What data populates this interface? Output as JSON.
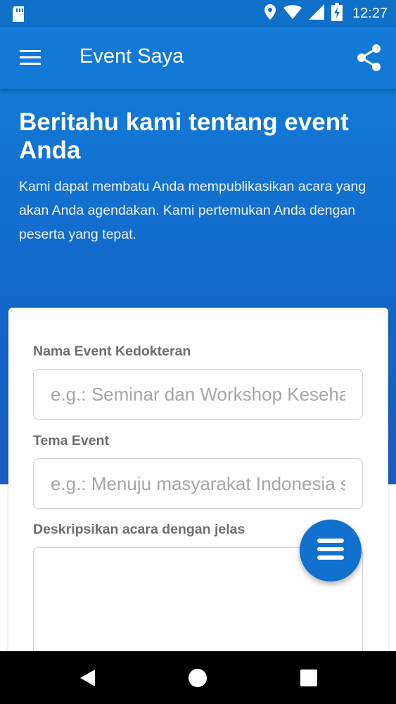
{
  "status_bar": {
    "time": "12:27",
    "icons": [
      "sd-card-icon",
      "location-icon",
      "wifi-icon",
      "signal-icon",
      "battery-charging-icon"
    ]
  },
  "app_bar": {
    "title": "Event Saya",
    "icons": [
      "hamburger-menu-icon",
      "share-icon"
    ]
  },
  "hero": {
    "title": "Beritahu kami tentang event Anda",
    "description": "Kami dapat membatu Anda mempublikasikan acara yang akan Anda agendakan. Kami pertemukan Anda dengan peserta yang tepat."
  },
  "form": {
    "event_name": {
      "label": "Nama Event Kedokteran",
      "placeholder": "e.g.: Seminar dan Workshop Kesehatan",
      "value": ""
    },
    "event_theme": {
      "label": "Tema Event",
      "placeholder": "e.g.: Menuju masyarakat Indonesia sehat",
      "value": ""
    },
    "description": {
      "label": "Deskripsikan acara dengan jelas",
      "value": ""
    }
  },
  "fab": {
    "icon": "menu-lines-icon"
  },
  "nav_bar": {
    "icons": [
      "back-icon",
      "home-icon",
      "recents-icon"
    ]
  },
  "colors": {
    "primary": "#1279d6",
    "status_bar": "#0e70c9",
    "fab": "#1271cf",
    "label_text": "#6e6e6e",
    "placeholder_text": "#a6a6a6"
  }
}
